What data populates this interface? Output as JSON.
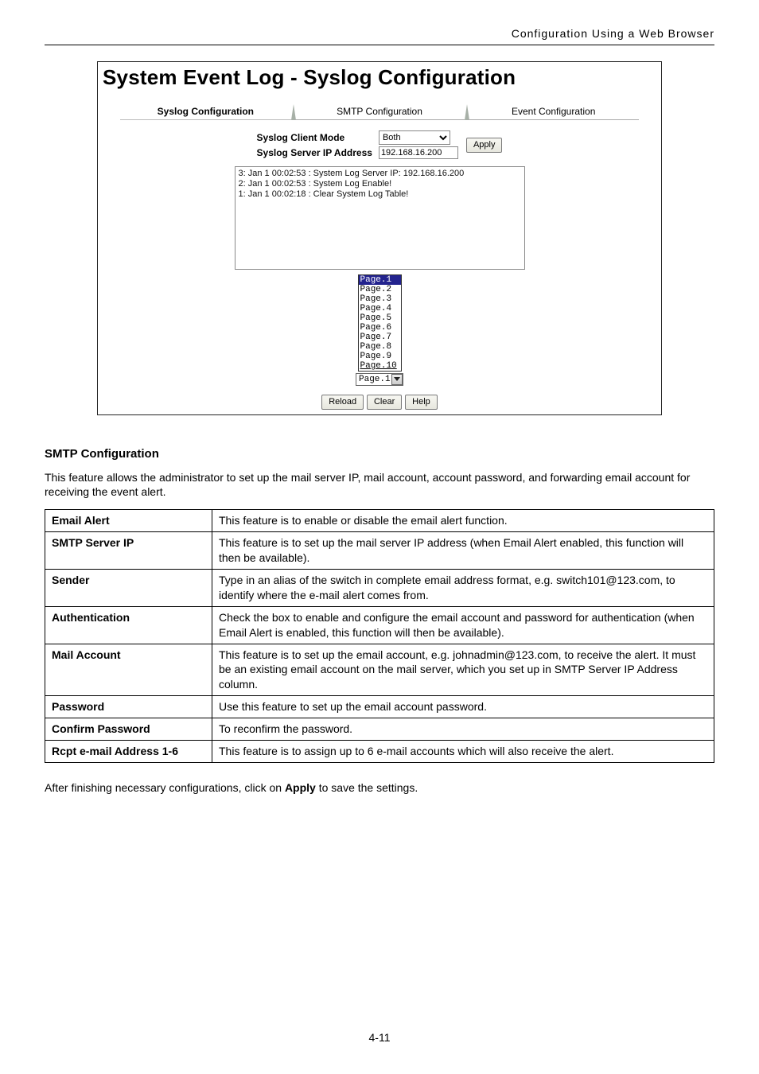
{
  "header_text": "Configuration Using a Web Browser",
  "screenshot": {
    "title": "System Event Log - Syslog Configuration",
    "tabs": {
      "active": "Syslog Configuration",
      "middle": "SMTP Configuration",
      "right": "Event Configuration"
    },
    "form": {
      "client_mode_label": "Syslog Client Mode",
      "client_mode_value": "Both",
      "server_ip_label": "Syslog Server IP Address",
      "server_ip_value": "192.168.16.200",
      "apply_label": "Apply"
    },
    "log_lines": "3: Jan 1 00:02:53 : System Log Server IP: 192.168.16.200\n2: Jan 1 00:02:53 : System Log Enable!\n1: Jan 1 00:02:18 : Clear System Log Table!",
    "pages": [
      "Page.1",
      "Page.2",
      "Page.3",
      "Page.4",
      "Page.5",
      "Page.6",
      "Page.7",
      "Page.8",
      "Page.9",
      "Page.10"
    ],
    "page_selected": "Page.1",
    "buttons": {
      "reload": "Reload",
      "clear": "Clear",
      "help": "Help"
    }
  },
  "section": {
    "heading": "SMTP Configuration",
    "intro": "This feature allows the administrator to set up the mail server IP, mail account, account password, and forwarding email account for receiving the event alert.",
    "rows": [
      {
        "label": "Email Alert",
        "desc": "This feature is to enable or disable the email alert function."
      },
      {
        "label": "SMTP Server IP",
        "desc": "This feature is to set up the mail server IP address (when Email Alert enabled, this function will then be available)."
      },
      {
        "label": "Sender",
        "desc": "Type in an alias of the switch in complete email address format, e.g. switch101@123.com, to identify where the e-mail alert comes from."
      },
      {
        "label": "Authentication",
        "desc": "Check the box to enable and configure the email account and password for authentication (when Email Alert is enabled, this function will then be available)."
      },
      {
        "label": "Mail Account",
        "desc": "This feature is to set up the email account, e.g. johnadmin@123.com, to receive the alert. It must be an existing email account on the mail server, which you set up in SMTP Server IP Address column."
      },
      {
        "label": "Password",
        "desc": "Use this feature to set up the email account password."
      },
      {
        "label": "Confirm Password",
        "desc": "To reconfirm the password."
      },
      {
        "label": "Rcpt e-mail Address 1-6",
        "desc": "This feature is to assign up to 6 e-mail accounts which will also receive the alert."
      }
    ],
    "apply_pre": "After finishing necessary configurations, click on ",
    "apply_bold": "Apply",
    "apply_post": " to save the settings."
  },
  "page_number": "4-11"
}
